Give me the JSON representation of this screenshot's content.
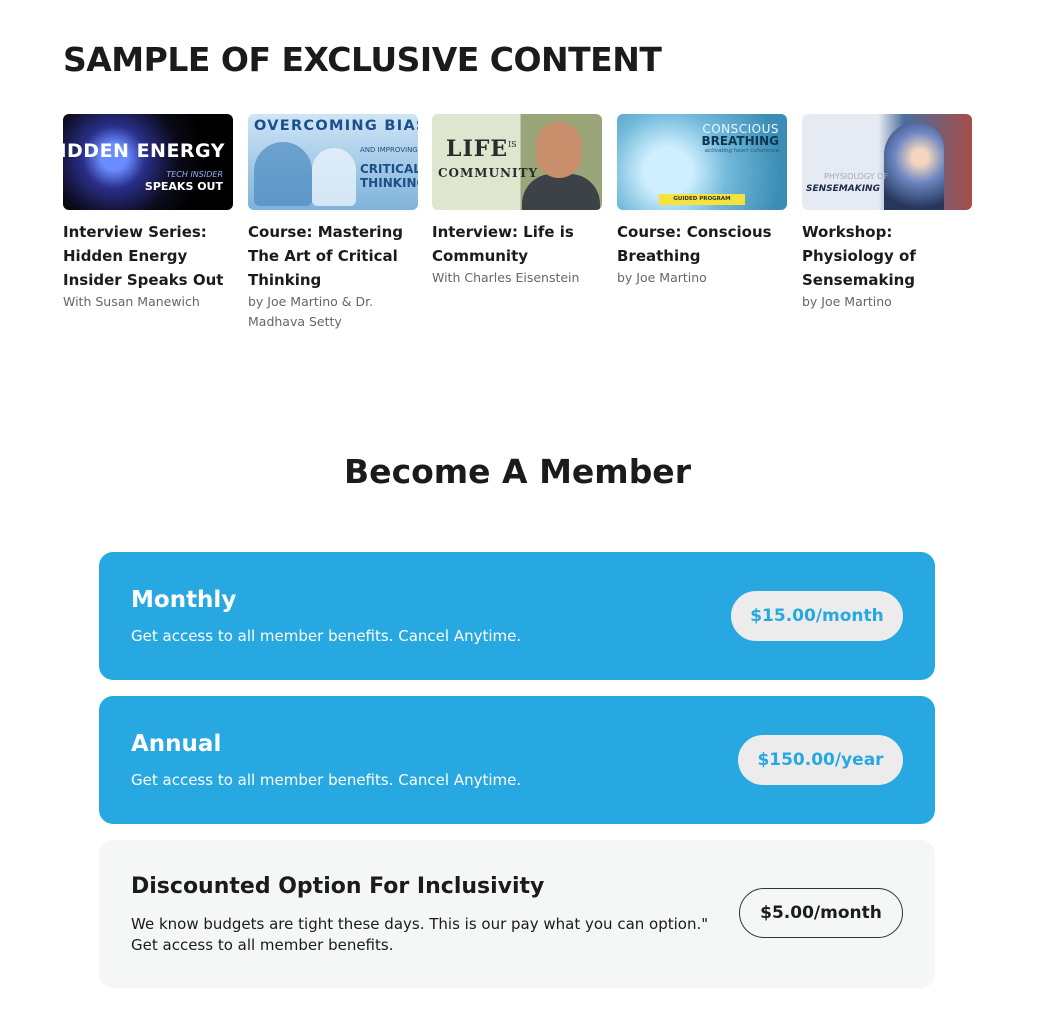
{
  "section_title": "SAMPLE OF EXCLUSIVE CONTENT",
  "content_cards": [
    {
      "thumb_text": [
        "HIDDEN ENERGY",
        "TECH INSIDER",
        "SPEAKS OUT"
      ],
      "title": "Interview Series: Hidden Energy Insider Speaks Out",
      "subtitle": "With Susan Manewich"
    },
    {
      "thumb_text": [
        "OVERCOMING BIAS",
        "AND IMPROVING",
        "CRITICAL THINKING"
      ],
      "title": "Course: Mastering The Art of Critical Thinking",
      "subtitle": "by Joe Martino & Dr. Madhava Setty"
    },
    {
      "thumb_text": [
        "LIFE",
        "IS",
        "COMMUNITY"
      ],
      "title": "Interview: Life is Community",
      "subtitle": "With Charles Eisenstein"
    },
    {
      "thumb_text": [
        "CONSCIOUS",
        "BREATHING",
        "activating heart coherence",
        "GUIDED PROGRAM"
      ],
      "title": "Course: Conscious Breathing",
      "subtitle": "by Joe Martino"
    },
    {
      "thumb_text": [
        "PHYSIOLOGY OF",
        "SENSEMAKING"
      ],
      "title": "Workshop: Physiology of Sensemaking",
      "subtitle": "by Joe Martino"
    }
  ],
  "member_title": "Become A Member",
  "plans": [
    {
      "name": "Monthly",
      "description": "Get access to all member benefits. Cancel Anytime.",
      "price": "$15.00/month",
      "style": "blue"
    },
    {
      "name": "Annual",
      "description": "Get access to all member benefits. Cancel Anytime.",
      "price": "$150.00/year",
      "style": "blue"
    },
    {
      "name": "Discounted Option For Inclusivity",
      "description_line1": "We know budgets are tight these days. This is our pay what you can option.\"",
      "description_line2": "Get access to all member benefits.",
      "price": "$5.00/month",
      "style": "light"
    }
  ],
  "colors": {
    "accent_blue": "#27a8e1",
    "price_pill": "#ececec",
    "light_card": "#f5f6f6",
    "heading": "#1b1b1b"
  }
}
